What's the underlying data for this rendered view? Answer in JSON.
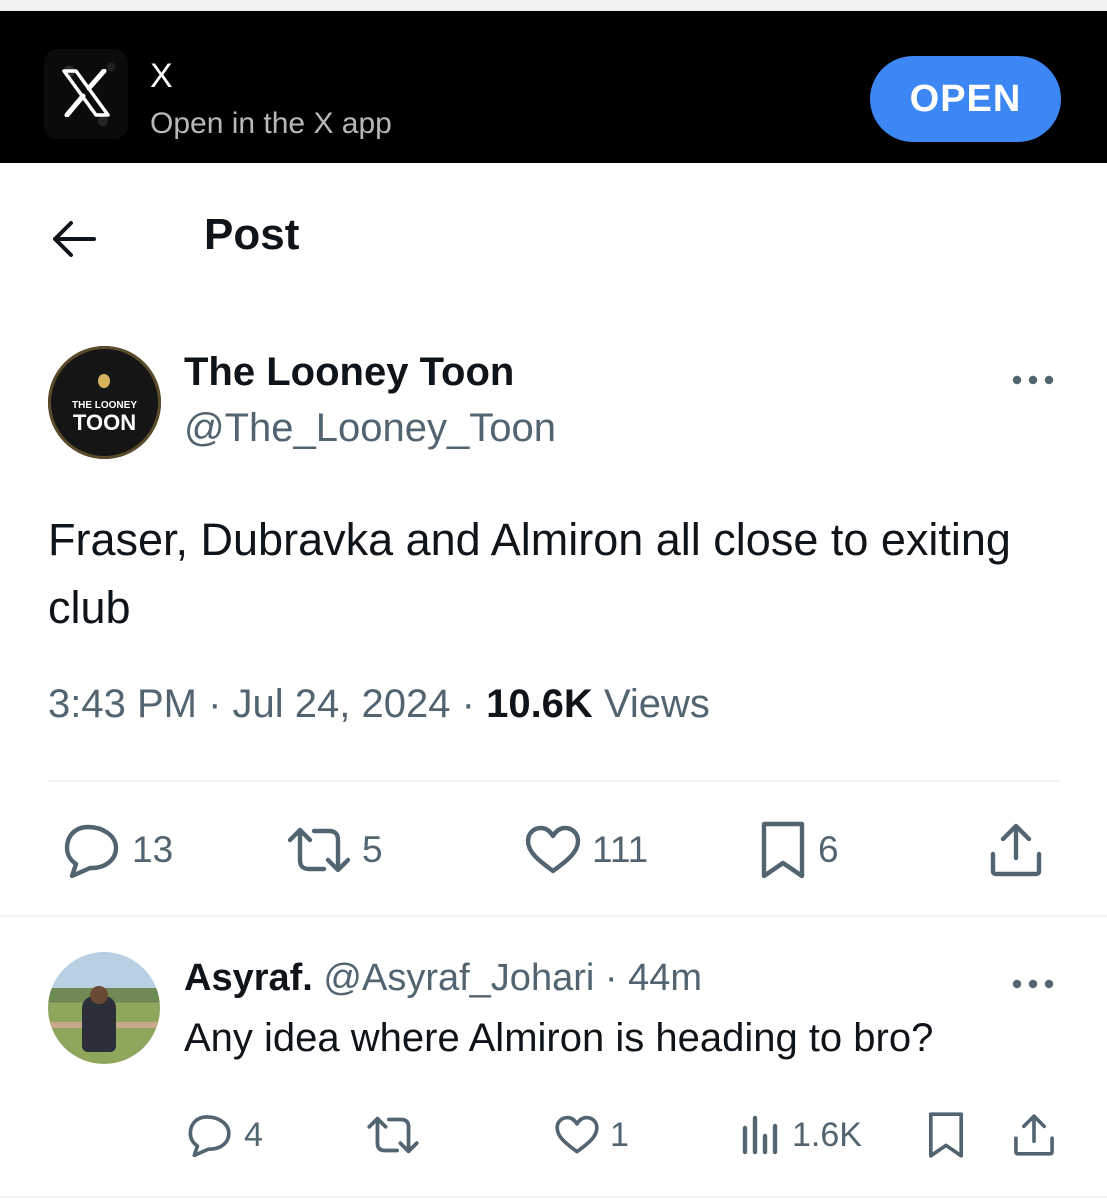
{
  "app_banner": {
    "app_name": "X",
    "subtitle": "Open in the X app",
    "open_label": "OPEN"
  },
  "header": {
    "title": "Post"
  },
  "post": {
    "author": {
      "display_name": "The Looney Toon",
      "handle": "@The_Looney_Toon",
      "avatar_text_small": "THE LOONEY",
      "avatar_text_large": "TOON"
    },
    "text": "Fraser, Dubravka and Almiron all close to exiting club",
    "time": "3:43 PM",
    "separator": "·",
    "date": "Jul 24, 2024",
    "views_count": "10.6K",
    "views_label": "Views",
    "stats": {
      "replies": "13",
      "reposts": "5",
      "likes": "111",
      "bookmarks": "6"
    }
  },
  "reply": {
    "display_name": "Asyraf.",
    "handle": "@Asyraf_Johari",
    "separator": "·",
    "time": "44m",
    "text": "Any idea where Almiron is heading to bro?",
    "stats": {
      "replies": "4",
      "likes": "1",
      "views": "1.6K"
    }
  },
  "icons": {
    "back": "arrow-left-icon",
    "more": "more-horizontal-icon",
    "reply": "speech-bubble-icon",
    "repost": "repost-icon",
    "like": "heart-icon",
    "bookmark": "bookmark-icon",
    "share": "share-icon",
    "views": "bar-chart-icon"
  },
  "colors": {
    "accent": "#3d87f5",
    "muted": "#536471",
    "text": "#0f1419",
    "banner_bg": "#000000"
  }
}
